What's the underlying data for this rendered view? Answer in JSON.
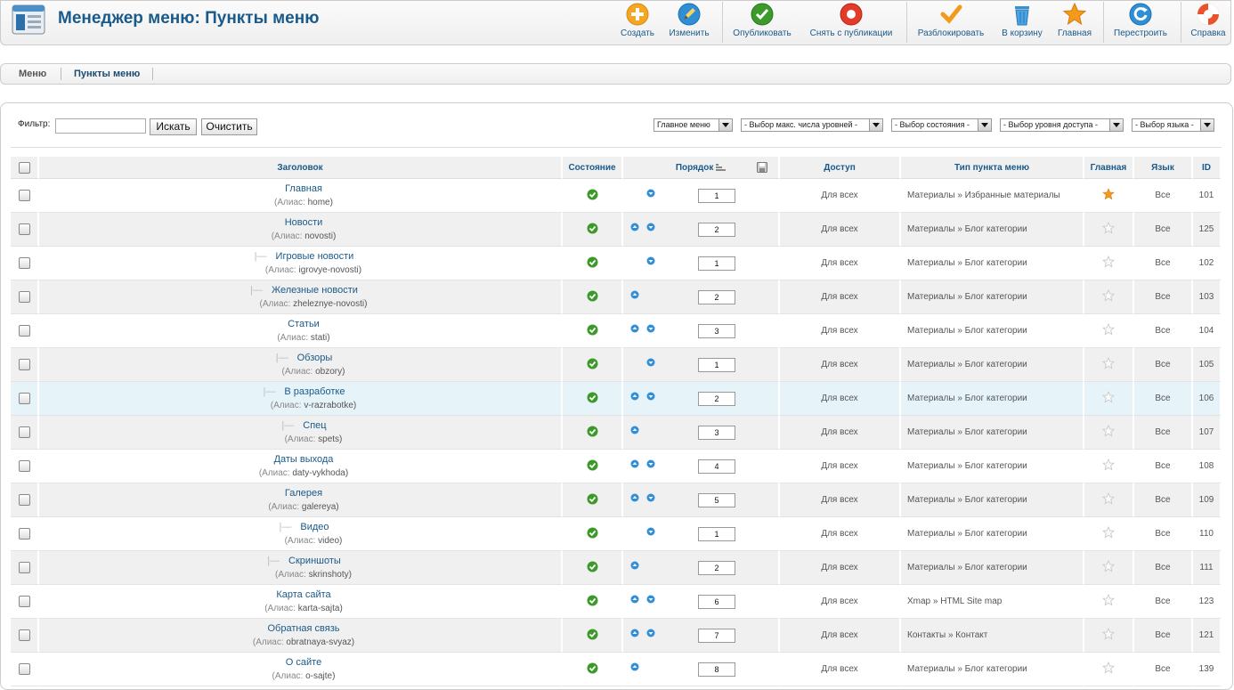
{
  "header": {
    "title": "Менеджер меню: Пункты меню",
    "buttons": [
      {
        "label": "Создать",
        "icon": "plus-icon"
      },
      {
        "label": "Изменить",
        "icon": "pencil-icon"
      },
      {
        "label": "Опубликовать",
        "icon": "check-icon"
      },
      {
        "label": "Снять с публикации",
        "icon": "unpublish-icon"
      },
      {
        "label": "Разблокировать",
        "icon": "unlock-check-icon"
      },
      {
        "label": "В корзину",
        "icon": "trash-icon"
      },
      {
        "label": "Главная",
        "icon": "star-icon"
      },
      {
        "label": "Перестроить",
        "icon": "refresh-icon"
      },
      {
        "label": "Справка",
        "icon": "help-icon"
      }
    ]
  },
  "submenu": {
    "items": [
      "Меню",
      "Пункты меню"
    ]
  },
  "filter": {
    "label": "Фильтр:",
    "value": "",
    "search_label": "Искать",
    "clear_label": "Очистить",
    "selects": [
      "Главное меню",
      "- Выбор макс. числа уровней -",
      "- Выбор состояния -",
      "- Выбор уровня доступа -",
      "- Выбор языка -"
    ]
  },
  "table": {
    "columns": {
      "title": "Заголовок",
      "state": "Состояние",
      "order": "Порядок",
      "access": "Доступ",
      "type": "Тип пункта меню",
      "home": "Главная",
      "lang": "Язык",
      "id": "ID"
    },
    "alias_label": "(Алиас:",
    "rows": [
      {
        "title": "Главная",
        "alias": "home",
        "order": "1",
        "access": "Для всех",
        "type": "Материалы » Избранные материалы",
        "lang": "Все",
        "id": "101"
      },
      {
        "title": "Новости",
        "alias": "novosti",
        "order": "2",
        "access": "Для всех",
        "type": "Материалы » Блог категории",
        "lang": "Все",
        "id": "125"
      },
      {
        "title": "Игровые новости",
        "alias": "igrovye-novosti",
        "order": "1",
        "access": "Для всех",
        "type": "Материалы » Блог категории",
        "lang": "Все",
        "id": "102"
      },
      {
        "title": "Железные новости",
        "alias": "zheleznye-novosti",
        "order": "2",
        "access": "Для всех",
        "type": "Материалы » Блог категории",
        "lang": "Все",
        "id": "103"
      },
      {
        "title": "Статьи",
        "alias": "stati",
        "order": "3",
        "access": "Для всех",
        "type": "Материалы » Блог категории",
        "lang": "Все",
        "id": "104"
      },
      {
        "title": "Обзоры",
        "alias": "obzory",
        "order": "1",
        "access": "Для всех",
        "type": "Материалы » Блог категории",
        "lang": "Все",
        "id": "105"
      },
      {
        "title": "В разработке",
        "alias": "v-razrabotke",
        "order": "2",
        "access": "Для всех",
        "type": "Материалы » Блог категории",
        "lang": "Все",
        "id": "106"
      },
      {
        "title": "Спец",
        "alias": "spets",
        "order": "3",
        "access": "Для всех",
        "type": "Материалы » Блог категории",
        "lang": "Все",
        "id": "107"
      },
      {
        "title": "Даты выхода",
        "alias": "daty-vykhoda",
        "order": "4",
        "access": "Для всех",
        "type": "Материалы » Блог категории",
        "lang": "Все",
        "id": "108"
      },
      {
        "title": "Галерея",
        "alias": "galereya",
        "order": "5",
        "access": "Для всех",
        "type": "Материалы » Блог категории",
        "lang": "Все",
        "id": "109"
      },
      {
        "title": "Видео",
        "alias": "video",
        "order": "1",
        "access": "Для всех",
        "type": "Материалы » Блог категории",
        "lang": "Все",
        "id": "110"
      },
      {
        "title": "Скриншоты",
        "alias": "skrinshoty",
        "order": "2",
        "access": "Для всех",
        "type": "Материалы » Блог категории",
        "lang": "Все",
        "id": "111"
      },
      {
        "title": "Карта сайта",
        "alias": "karta-sajta",
        "order": "6",
        "access": "Для всех",
        "type": "Xmap » HTML Site map",
        "lang": "Все",
        "id": "123"
      },
      {
        "title": "Обратная связь",
        "alias": "obratnaya-svyaz",
        "order": "7",
        "access": "Для всех",
        "type": "Контакты » Контакт",
        "lang": "Все",
        "id": "121"
      },
      {
        "title": "О сайте",
        "alias": "o-sajte",
        "order": "8",
        "access": "Для всех",
        "type": "Материалы » Блог категории",
        "lang": "Все",
        "id": "139"
      }
    ]
  }
}
